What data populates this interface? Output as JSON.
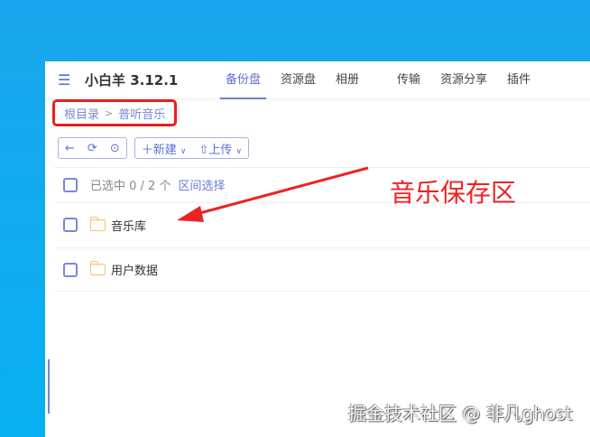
{
  "app": {
    "title": "小白羊 3.12.1"
  },
  "tabs": [
    "备份盘",
    "资源盘",
    "相册",
    "传输",
    "资源分享",
    "插件"
  ],
  "breadcrumb": {
    "root": "根目录",
    "current": "普听音乐"
  },
  "toolbar": {
    "new_label": "新建",
    "upload_label": "上传"
  },
  "selection": {
    "status": "已选中 0 / 2 个",
    "range_select": "区间选择"
  },
  "files": [
    {
      "name": "音乐库"
    },
    {
      "name": "用户数据"
    }
  ],
  "annotation": "音乐保存区",
  "watermark": "掘金技术社区 @ 非凡ghost",
  "colors": {
    "accent": "#5b6fd6",
    "highlight": "#f01c1c",
    "folder": "#f7c46c"
  }
}
